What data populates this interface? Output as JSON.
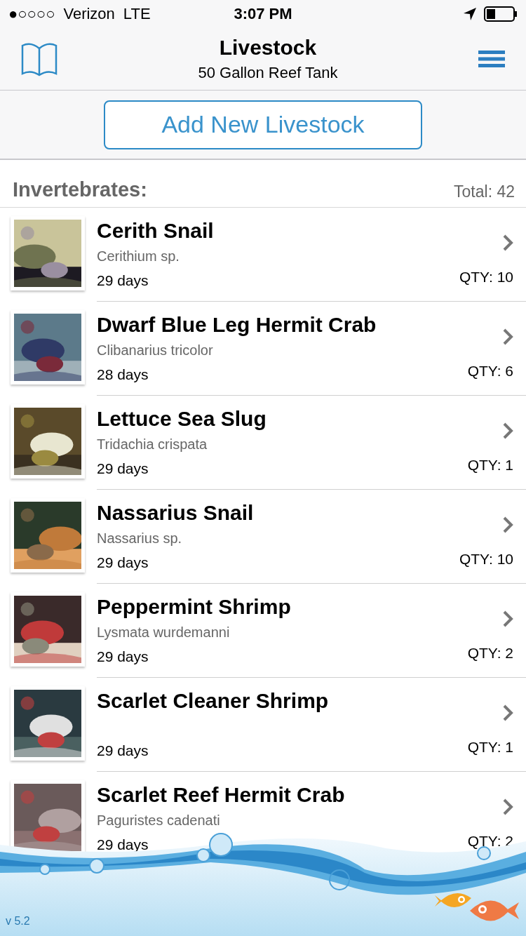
{
  "status_bar": {
    "signal": "●○○○○",
    "carrier": "Verizon",
    "network": "LTE",
    "time": "3:07 PM"
  },
  "nav": {
    "title": "Livestock",
    "subtitle": "50 Gallon Reef Tank"
  },
  "add_button": "Add New Livestock",
  "section": {
    "title": "Invertebrates:",
    "total": "Total: 42"
  },
  "rows": [
    {
      "name": "Cerith Snail",
      "scientific": "Cerithium sp.",
      "age": "29 days",
      "qty": "QTY: 10"
    },
    {
      "name": "Dwarf Blue Leg Hermit Crab",
      "scientific": "Clibanarius tricolor",
      "age": "28 days",
      "qty": "QTY: 6"
    },
    {
      "name": "Lettuce Sea Slug",
      "scientific": "Tridachia crispata",
      "age": "29 days",
      "qty": "QTY: 1"
    },
    {
      "name": "Nassarius Snail",
      "scientific": "Nassarius sp.",
      "age": "29 days",
      "qty": "QTY: 10"
    },
    {
      "name": "Peppermint Shrimp",
      "scientific": "Lysmata wurdemanni",
      "age": "29 days",
      "qty": "QTY: 2"
    },
    {
      "name": "Scarlet Cleaner Shrimp",
      "age": "29 days",
      "qty": "QTY: 1"
    },
    {
      "name": "Scarlet Reef Hermit Crab",
      "scientific": "Paguristes cadenati",
      "age": "29 days",
      "qty": "QTY: 2"
    }
  ],
  "version": "v 5.2"
}
